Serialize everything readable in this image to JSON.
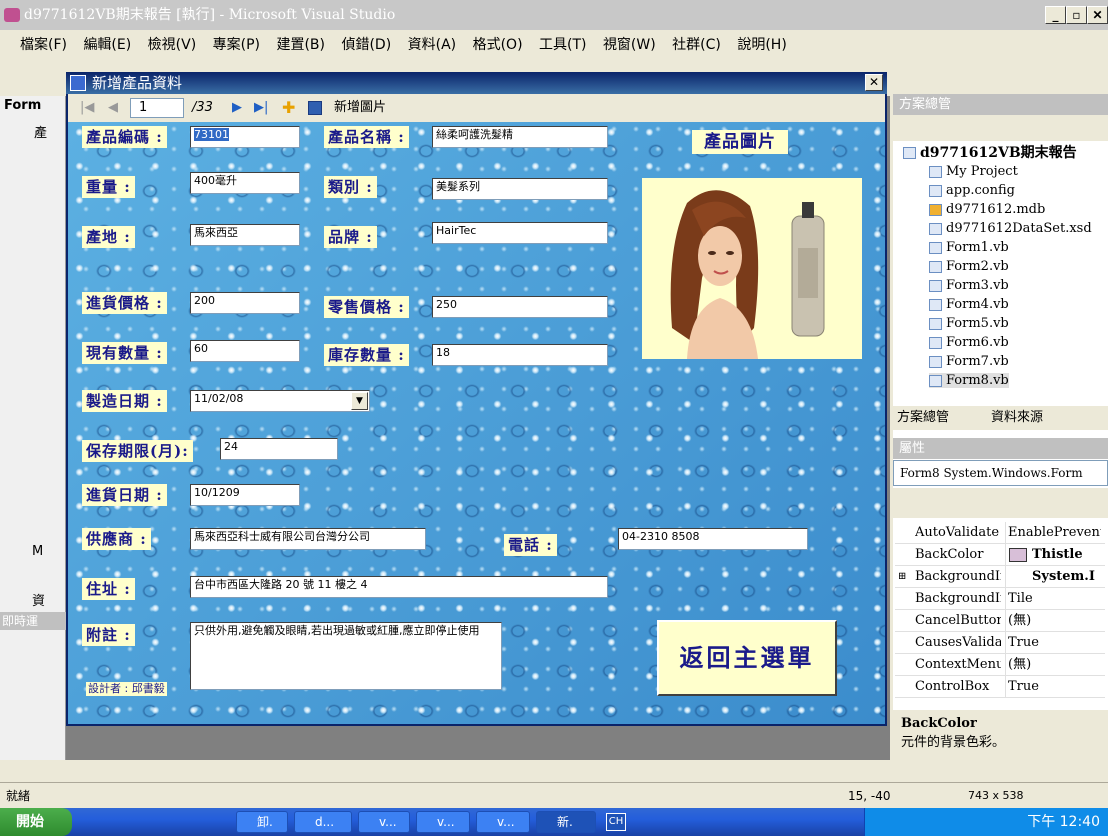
{
  "window": {
    "title": "d9771612VB期末報告 [執行] - Microsoft Visual Studio"
  },
  "menu": [
    "檔案(F)",
    "編輯(E)",
    "檢視(V)",
    "專案(P)",
    "建置(B)",
    "偵錯(D)",
    "資料(A)",
    "格式(O)",
    "工具(T)",
    "視窗(W)",
    "社群(C)",
    "說明(H)"
  ],
  "doc_tab": {
    "label": "Form",
    "sub": "產",
    "left1": "M",
    "left2": "資",
    "left3": "即時運"
  },
  "form": {
    "title": "新增產品資料",
    "close": "✕",
    "nav": {
      "position": "1",
      "total": "/33",
      "add_image": "新增圖片"
    },
    "fields": {
      "code_label": "產品編碼 :",
      "code": "73101",
      "name_label": "產品名稱 :",
      "name": "絲柔呵護洗髮精",
      "weight_label": "重量 :",
      "weight": "400毫升",
      "category_label": "類別 :",
      "category": "美髮系列",
      "origin_label": "產地 :",
      "origin": "馬來西亞",
      "brand_label": "品牌 :",
      "brand": "HairTec",
      "cost_label": "進貨價格 :",
      "cost": "200",
      "retail_label": "零售價格 :",
      "retail": "250",
      "qty_label": "現有數量 :",
      "qty": "60",
      "stock_label": "庫存數量 :",
      "stock": "18",
      "mfg_label": "製造日期 :",
      "mfg": "11/02/08",
      "shelf_label": "保存期限(月):",
      "shelf": "24",
      "purchase_label": "進貨日期 :",
      "purchase": "10/1209",
      "supplier_label": "供應商 :",
      "supplier": "馬來西亞科士威有限公司台灣分公司",
      "phone_label": "電話 :",
      "phone": "04-2310 8508",
      "address_label": "住址 :",
      "address": "台中市西區大隆路 20 號 11 樓之 4",
      "note_label": "附註 :",
      "note": "只供外用,避免觸及眼睛,若出現過敏或紅腫,應立即停止使用"
    },
    "image_label": "產品圖片",
    "back_button": "返回主選單",
    "designer": "設計者 : 邱書毅"
  },
  "solution": {
    "panel_title": "方案總管",
    "root": "d9771612VB期末報告",
    "items": [
      "My Project",
      "app.config",
      "d9771612.mdb",
      "d9771612DataSet.xsd",
      "Form1.vb",
      "Form2.vb",
      "Form3.vb",
      "Form4.vb",
      "Form5.vb",
      "Form6.vb",
      "Form7.vb",
      "Form8.vb"
    ],
    "tab1": "方案總管",
    "tab2": "資料來源"
  },
  "properties": {
    "panel_title": "屬性",
    "object": "Form8 System.Windows.Form",
    "rows": [
      {
        "name": "AutoValidate",
        "value": "EnablePrevent"
      },
      {
        "name": "BackColor",
        "value": "Thistle"
      },
      {
        "name": "BackgroundIr",
        "value": "System.I"
      },
      {
        "name": "BackgroundIr",
        "value": "Tile"
      },
      {
        "name": "CancelButton",
        "value": "(無)"
      },
      {
        "name": "CausesValidat",
        "value": "True"
      },
      {
        "name": "ContextMenu",
        "value": "(無)"
      },
      {
        "name": "ControlBox",
        "value": "True"
      }
    ],
    "desc_title": "BackColor",
    "desc": "元件的背景色彩。"
  },
  "status": {
    "text": "就緒",
    "pos": "15, -40",
    "size": "743 x 538"
  },
  "taskbar": {
    "start": "開始",
    "buttons": [
      "卸.",
      "d...",
      "v...",
      "v...",
      "v...",
      "新."
    ],
    "ime": "CH",
    "clock": "下午 12:40"
  },
  "colors": {
    "thistle": "#d8bfd8",
    "label_bg": "#ffffcc",
    "label_fg": "#1a1a8a"
  }
}
